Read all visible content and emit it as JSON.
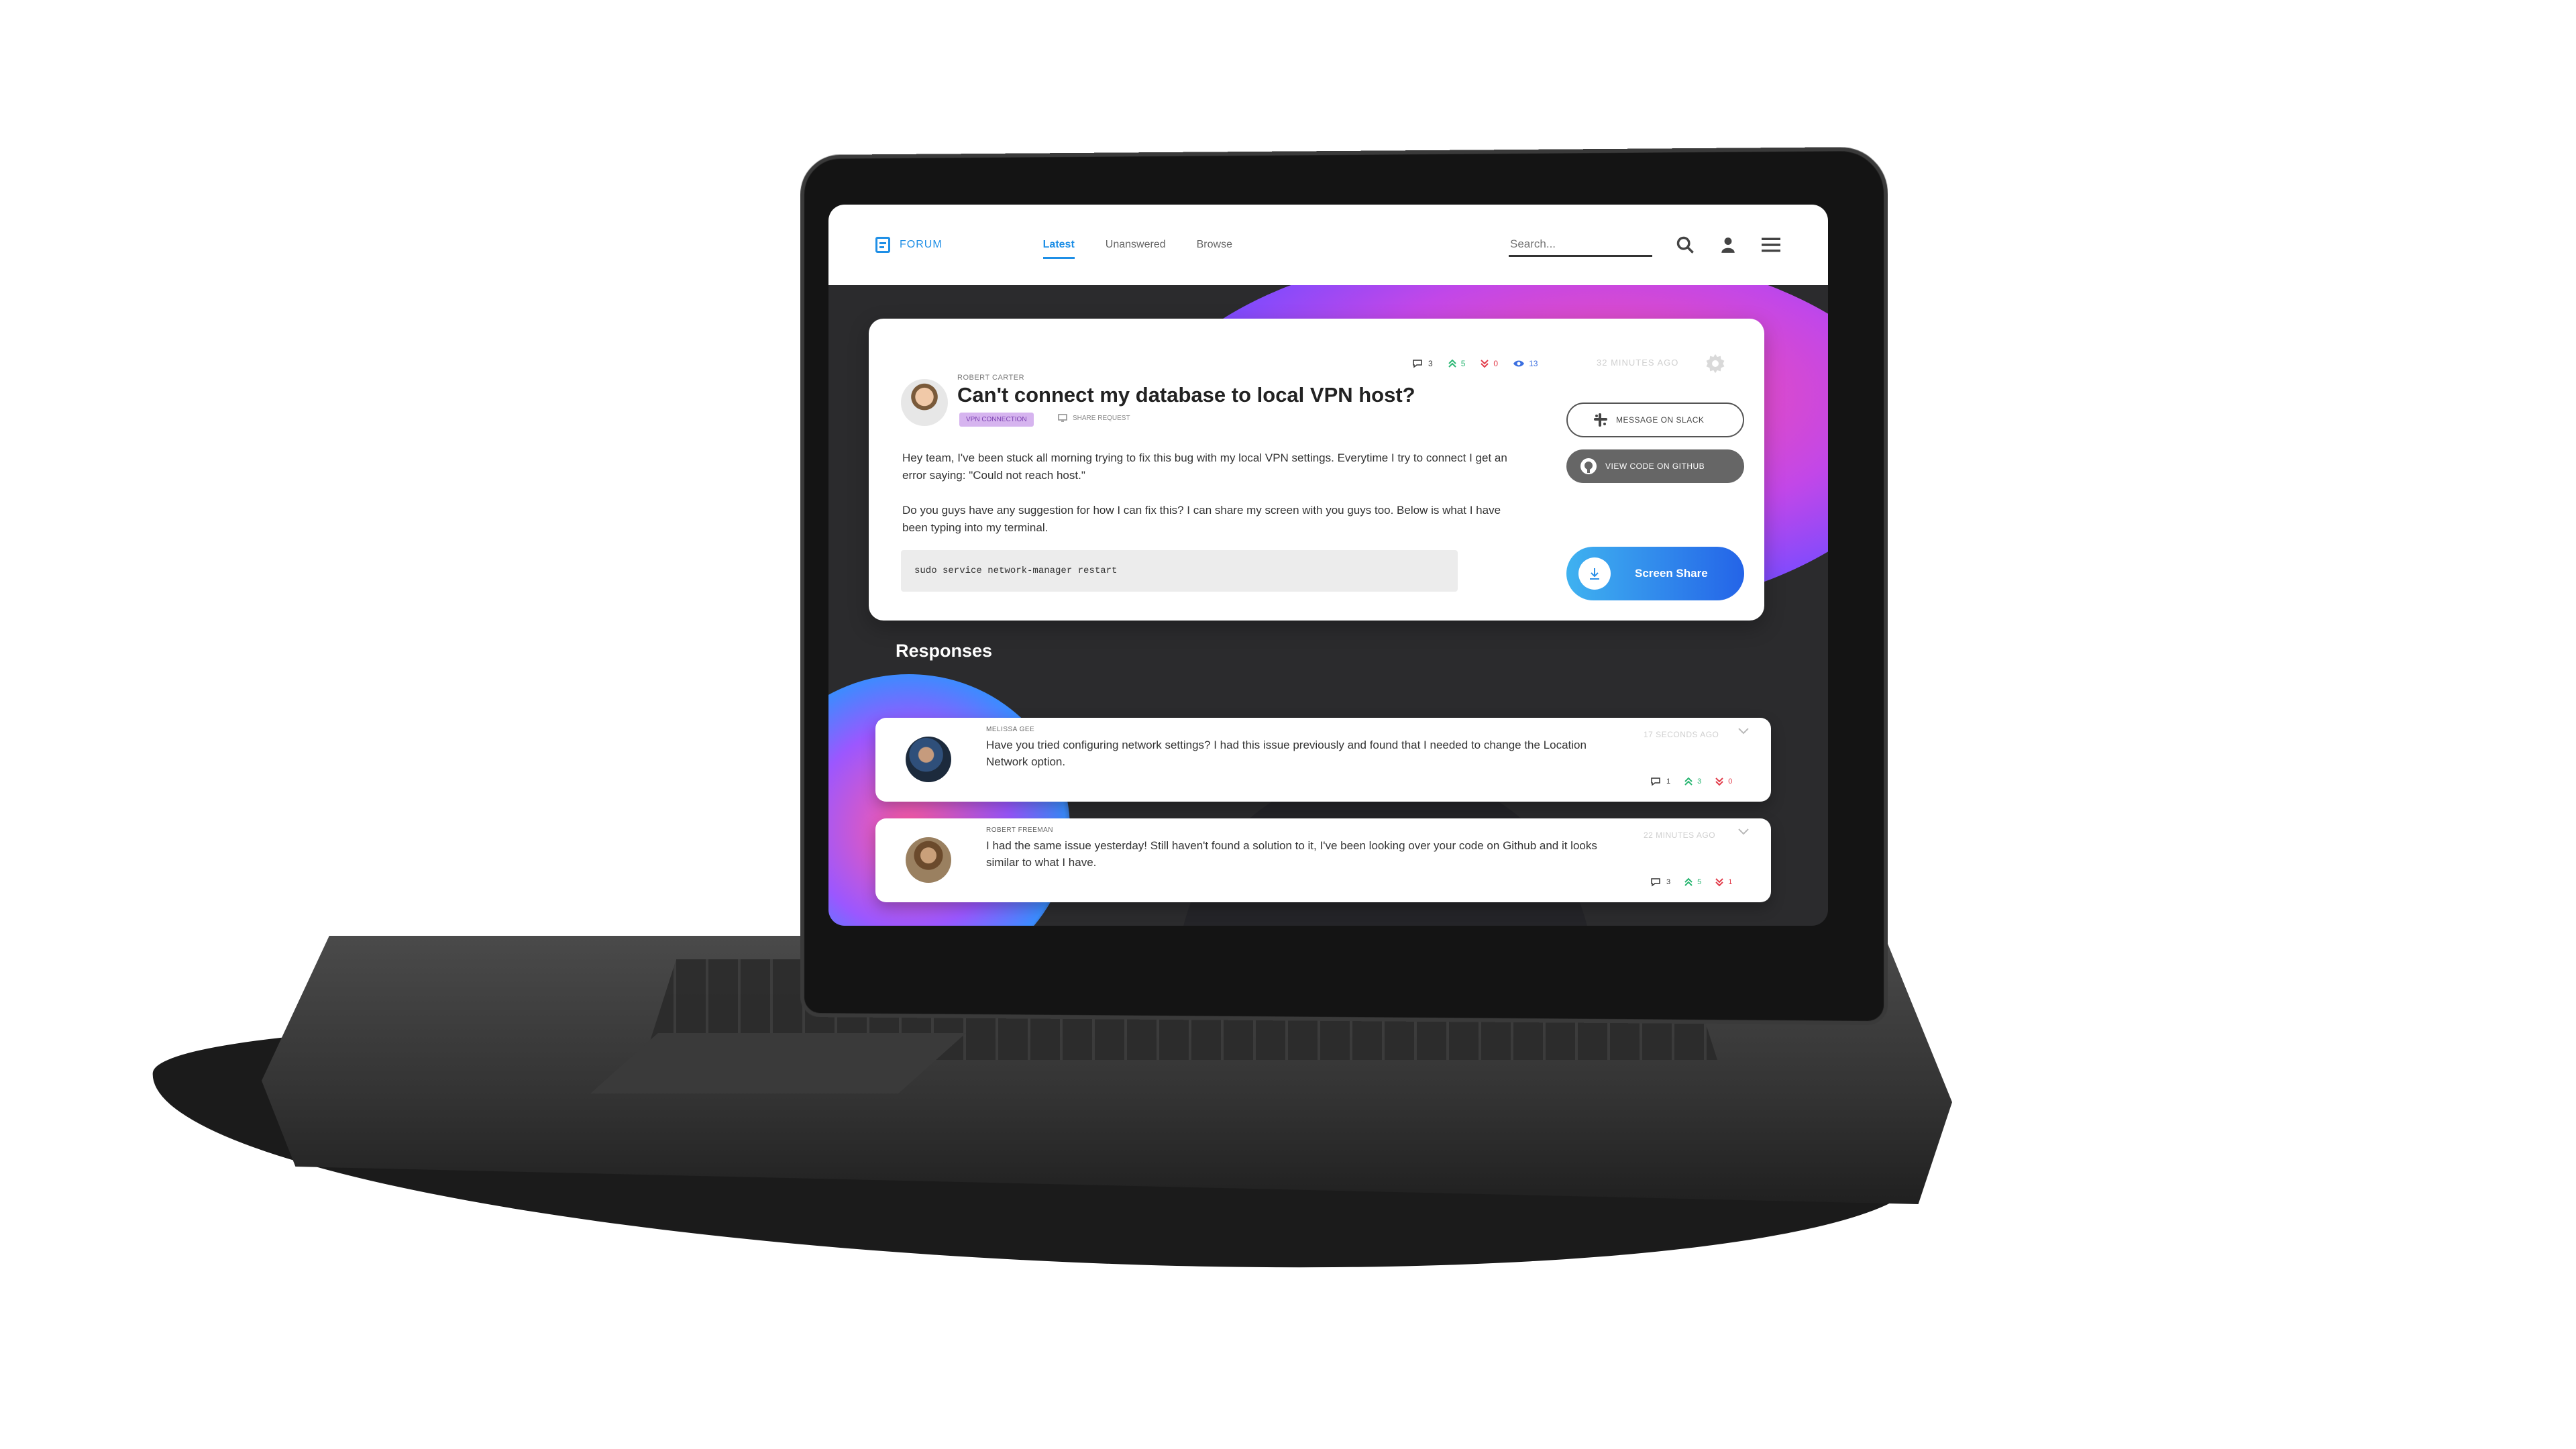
{
  "nav": {
    "brand": "FORUM",
    "tabs": [
      {
        "label": "Latest",
        "active": true
      },
      {
        "label": "Unanswered",
        "active": false
      },
      {
        "label": "Browse",
        "active": false
      }
    ],
    "search_placeholder": "Search...",
    "icons": [
      "search-icon",
      "user-icon",
      "menu-icon"
    ]
  },
  "question": {
    "author": "ROBERT CARTER",
    "title": "Can't connect my database to local VPN host?",
    "tag": "VPN CONNECTION",
    "share_request": "SHARE REQUEST",
    "body_p1": "Hey team, I've been stuck all morning trying to fix this bug with my local VPN settings. Everytime I try to connect I get an error saying: \"Could not reach host.\"",
    "body_p2": "Do you guys have any suggestion for how I can fix this? I can share my screen with you guys too. Below is what I have been typing into my terminal.",
    "code": "sudo service network-manager restart",
    "stats": {
      "comments": "3",
      "upvotes": "5",
      "downvotes": "0",
      "views": "13"
    },
    "time": "32 MINUTES AGO",
    "buttons": {
      "slack": "MESSAGE ON SLACK",
      "github": "VIEW CODE ON GITHUB",
      "screen_share": "Screen Share"
    }
  },
  "responses": {
    "title": "Responses",
    "items": [
      {
        "author": "MELISSA GEE",
        "text": "Have you tried configuring network settings? I had this issue previously and found that I needed to change the Location Network option.",
        "time": "17 SECONDS AGO",
        "comments": "1",
        "upvotes": "3",
        "downvotes": "0"
      },
      {
        "author": "ROBERT FREEMAN",
        "text": "I had the same issue yesterday! Still haven't found a solution to it, I've been looking over your code on Github and it looks similar to what I have.",
        "time": "22 MINUTES AGO",
        "comments": "3",
        "upvotes": "5",
        "downvotes": "1"
      }
    ]
  },
  "colors": {
    "accent": "#1f8fe6",
    "upvote": "#2bb673",
    "downvote": "#e23d4b",
    "tag_bg": "#d6b4ef",
    "share_gradient_start": "#3fb2f0",
    "share_gradient_end": "#2464e8"
  }
}
